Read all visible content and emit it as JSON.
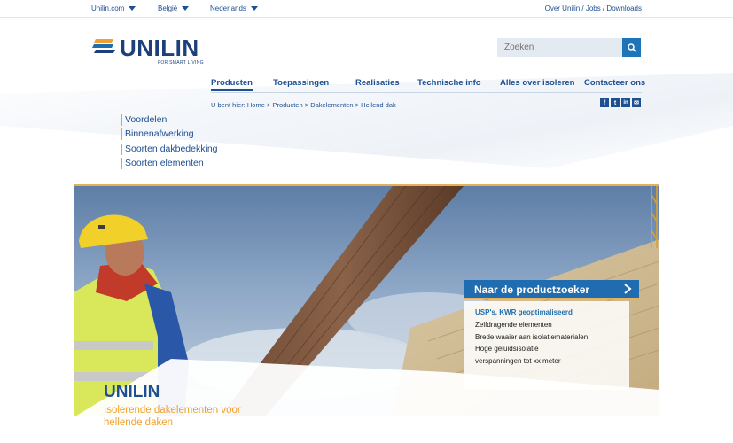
{
  "topbar": {
    "site_select": "Unilin.com",
    "country_select": "België",
    "language_select": "Nederlands",
    "utility_links": "Over Unilin / Jobs / Downloads"
  },
  "logo": {
    "text": "UNILIN",
    "tagline": "FOR SMART LIVING"
  },
  "search": {
    "placeholder": "Zoeken"
  },
  "nav": {
    "items": [
      "Producten",
      "Toepassingen",
      "Realisaties",
      "Technische info",
      "Alles over isoleren",
      "Contacteer ons"
    ]
  },
  "breadcrumb": {
    "prefix": "U bent hier:",
    "items": [
      "Home",
      "Producten",
      "Dakelementen",
      "Hellend dak"
    ]
  },
  "social": {
    "icons": [
      "facebook-icon",
      "twitter-icon",
      "linkedin-icon",
      "mail-icon"
    ],
    "glyphs": [
      "f",
      "t",
      "in",
      "✉"
    ]
  },
  "subnav": {
    "items": [
      "Voordelen",
      "Binnenafwerking",
      "Soorten dakbedekking",
      "Soorten elementen"
    ]
  },
  "hero": {
    "title": "UNILIN",
    "subtitle": "Isolerende dakelementen voor hellende daken"
  },
  "productfinder": {
    "button_label": "Naar de productzoeker",
    "usp_heading": "USP's, KWR geoptimaliseerd",
    "usp_items": [
      "Zelfdragende elementen",
      "Brede waaier aan isolatiematerialen",
      "Hoge geluidsisolatie",
      "verspanningen tot xx meter"
    ]
  },
  "colors": {
    "brand_blue": "#1d4f91",
    "accent_orange": "#f0a030",
    "button_blue": "#1f6db0"
  }
}
